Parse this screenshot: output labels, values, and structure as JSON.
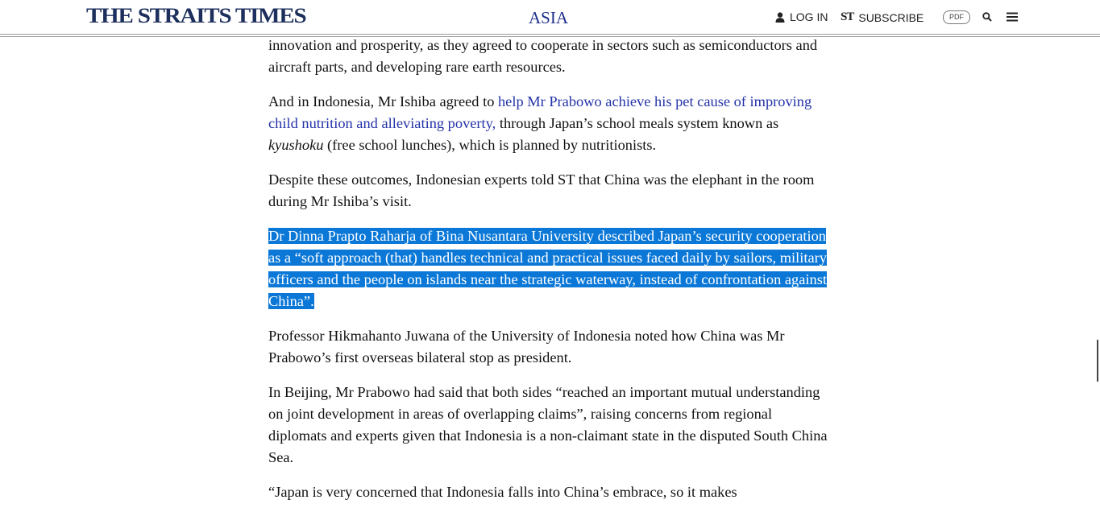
{
  "header": {
    "logo": "THE STRAITS TIMES",
    "section": "ASIA",
    "login_label": "LOG IN",
    "subscribe_mark": "ST",
    "subscribe_label": "SUBSCRIBE",
    "pdf_label": "PDF"
  },
  "icons": {
    "login": "user-icon",
    "search": "search-icon",
    "menu": "hamburger-menu-icon"
  },
  "colors": {
    "logo": "#1d2f5c",
    "section": "#1d2f8c",
    "link": "#2433a8",
    "selection": "#0b78d7"
  },
  "article": {
    "p1": "innovation and prosperity, as they agreed to cooperate in sectors such as semiconductors and aircraft parts, and developing rare earth resources.",
    "p2_pre": "And in Indonesia, Mr Ishiba agreed to ",
    "p2_link": "help Mr Prabowo achieve his pet cause of improving child nutrition and alleviating poverty,",
    "p2_mid": " through Japan’s school meals system known as ",
    "p2_em": "kyushoku",
    "p2_post": " (free school lunches), which is planned by nutritionists.",
    "p3": "Despite these outcomes, Indonesian experts told ST that China was the elephant in the room during Mr Ishiba’s visit.",
    "p4": "Dr Dinna Prapto Raharja of Bina Nusantara University described Japan’s security cooperation as a “soft approach (that) handles technical and practical issues faced daily by sailors, military officers and the people on islands near the strategic waterway, instead of confrontation against China”.",
    "p5": "Professor Hikmahanto Juwana of the University of Indonesia noted how China was Mr Prabowo’s first overseas bilateral stop as president.",
    "p6": "In Beijing, Mr Prabowo had said that both sides “reached an important mutual understanding on joint development in areas of overlapping claims”, raising concerns from regional diplomats and experts given that Indonesia is a non-claimant state in the disputed South China Sea.",
    "p7": "“Japan is very concerned that Indonesia falls into China’s embrace, so it makes"
  }
}
